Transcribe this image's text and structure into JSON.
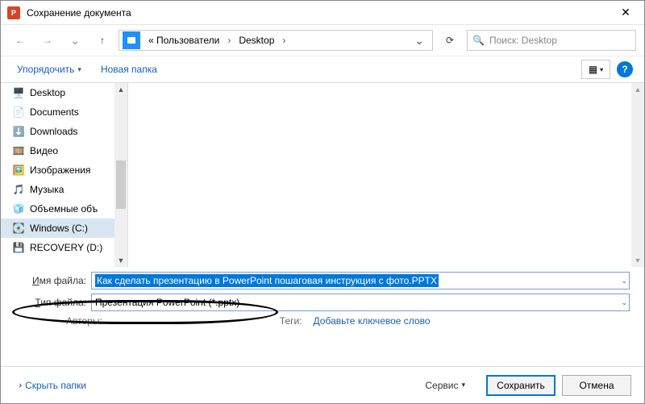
{
  "window": {
    "title": "Сохранение документа"
  },
  "nav": {
    "address_prefix": "« Пользователи",
    "address_seg2": "Desktop",
    "search_placeholder": "Поиск: Desktop"
  },
  "toolbar": {
    "organize": "Упорядочить",
    "new_folder": "Новая папка"
  },
  "tree": {
    "items": [
      {
        "icon": "🖥️",
        "label": "Desktop"
      },
      {
        "icon": "📄",
        "label": "Documents"
      },
      {
        "icon": "⬇️",
        "label": "Downloads"
      },
      {
        "icon": "🎞️",
        "label": "Видео"
      },
      {
        "icon": "🖼️",
        "label": "Изображения"
      },
      {
        "icon": "🎵",
        "label": "Музыка"
      },
      {
        "icon": "🧊",
        "label": "Объемные объ"
      },
      {
        "icon": "💽",
        "label": "Windows (C:)"
      },
      {
        "icon": "💾",
        "label": "RECOVERY (D:)"
      }
    ]
  },
  "form": {
    "filename_label_u": "И",
    "filename_label_rest": "мя файла:",
    "filename_value": "Как сделать презентацию в PowerPoint пошаговая инструкция с фото.PPTX",
    "filetype_label_u": "Т",
    "filetype_label_rest": "ип файла:",
    "filetype_value": "Презентация PowerPoint (*.pptx)",
    "authors_label": "Авторы:",
    "tags_label": "Теги:",
    "tags_placeholder": "Добавьте ключевое слово"
  },
  "footer": {
    "hide_folders": "Скрыть папки",
    "service": "Сервис",
    "save": "Сохранить",
    "cancel": "Отмена"
  }
}
